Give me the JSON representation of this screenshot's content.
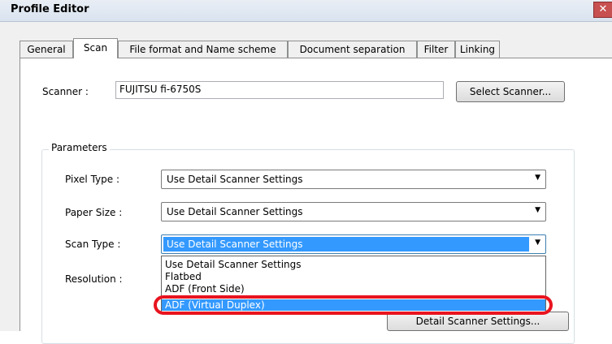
{
  "window": {
    "title": "Profile Editor",
    "close_glyph": "✕"
  },
  "tabs": [
    {
      "label": "General"
    },
    {
      "label": "Scan",
      "active": true
    },
    {
      "label": "File format and Name scheme"
    },
    {
      "label": "Document separation"
    },
    {
      "label": "Filter"
    },
    {
      "label": "Linking"
    }
  ],
  "scanner": {
    "label": "Scanner :",
    "value": "FUJITSU fi-6750S",
    "select_button": "Select Scanner..."
  },
  "parameters": {
    "group_label": "Parameters",
    "pixel_type": {
      "label": "Pixel Type :",
      "value": "Use Detail Scanner Settings"
    },
    "paper_size": {
      "label": "Paper Size :",
      "value": "Use Detail Scanner Settings"
    },
    "scan_type": {
      "label": "Scan Type :",
      "value": "Use Detail Scanner Settings"
    },
    "resolution": {
      "label": "Resolution :"
    },
    "scan_type_options": [
      "Use Detail Scanner Settings",
      "Flatbed",
      "ADF (Front Side)",
      "ADF (Virtual Duplex)"
    ],
    "selected_option_index": 3,
    "detail_button": "Detail Scanner Settings..."
  },
  "colors": {
    "selection": "#3399ff",
    "highlight_ring": "#e8141f",
    "close_button": "#c75050"
  }
}
